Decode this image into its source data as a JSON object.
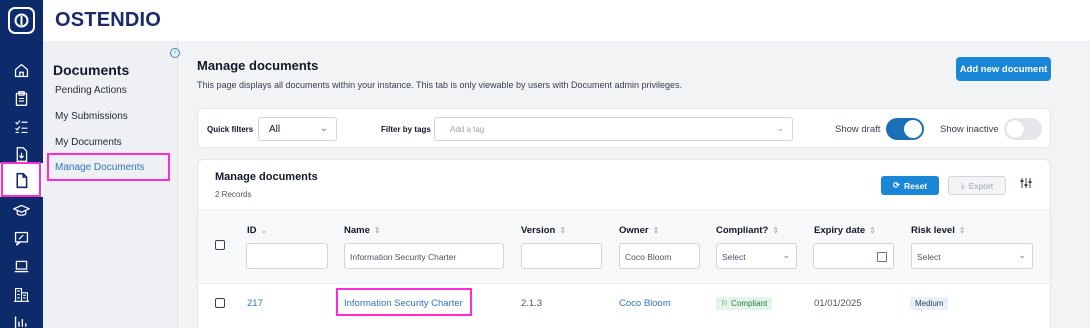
{
  "app": {
    "brand": "OSTENDIO"
  },
  "rail": {
    "items": [
      "home-icon",
      "clipboard-icon",
      "checklist-icon",
      "file-import-icon",
      "document-icon",
      "graduation-cap-icon",
      "chat-icon",
      "laptop-icon",
      "buildings-icon",
      "bar-chart-icon"
    ],
    "active": "document-icon"
  },
  "subnav": {
    "title": "Documents",
    "items": [
      "Pending Actions",
      "My Submissions",
      "My Documents",
      "Manage Documents"
    ],
    "active": "Manage Documents"
  },
  "header": {
    "title": "Manage documents",
    "description": "This page displays all documents within your instance. This tab is only viewable by users with Document admin privileges.",
    "add_button": "Add new document"
  },
  "filters": {
    "quick_label": "Quick filters",
    "quick_value": "All",
    "tags_label": "Filter by tags",
    "tags_placeholder": "Add a tag",
    "show_draft_label": "Show draft",
    "show_draft_on": true,
    "show_inactive_label": "Show inactive",
    "show_inactive_on": false
  },
  "table": {
    "title": "Manage documents",
    "records": "2 Records",
    "reset_label": "Reset",
    "export_label": "Export",
    "columns": [
      "ID",
      "Name",
      "Version",
      "Owner",
      "Compliant?",
      "Expiry date",
      "Risk level"
    ],
    "filter_values": {
      "name": "Information Security Charter",
      "owner": "Coco Bloom",
      "compliant": "Select",
      "risk": "Select"
    },
    "rows": [
      {
        "id": "217",
        "name": "Information Security Charter",
        "version": "2.1.3",
        "owner": "Coco Bloom",
        "compliant": "Compliant",
        "expiry": "01/01/2025",
        "risk": "Medium"
      }
    ]
  },
  "colors": {
    "rail": "#0d2a6b",
    "primary": "#1a86d8",
    "link": "#2f74c0",
    "highlight": "#ff2bd6"
  }
}
